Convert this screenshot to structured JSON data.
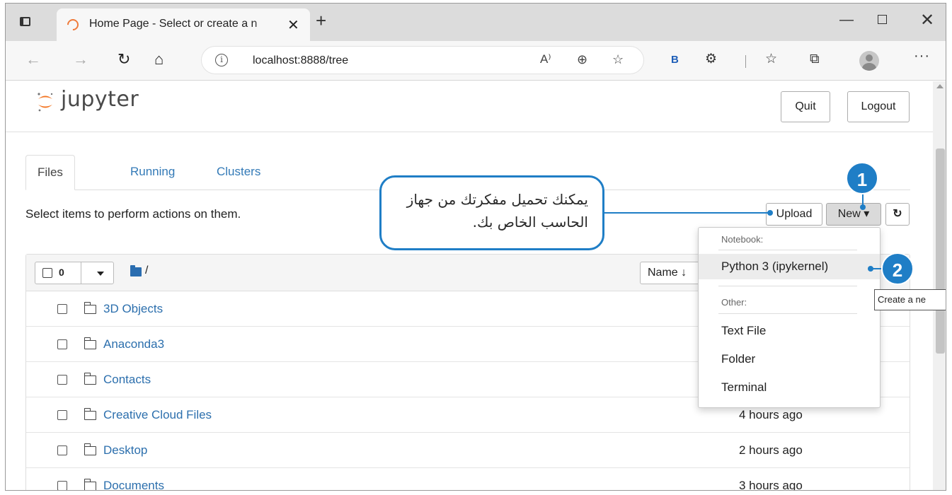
{
  "browser": {
    "tab_title": "Home Page - Select or create a n",
    "url": "localhost:8888/tree",
    "bing_label": "B"
  },
  "header": {
    "brand": "jupyter",
    "quit_label": "Quit",
    "logout_label": "Logout"
  },
  "tabs": [
    {
      "label": "Files",
      "active": true
    },
    {
      "label": "Running",
      "active": false
    },
    {
      "label": "Clusters",
      "active": false
    }
  ],
  "toolbar": {
    "select_message": "Select items to perform actions on them.",
    "upload_label": "Upload",
    "new_label": "New ▾",
    "refresh_glyph": "↻"
  },
  "list_header": {
    "selected_count": "0",
    "root_path": "/",
    "sort_label": "Name ↓"
  },
  "files": [
    {
      "name": "3D Objects",
      "modified": ""
    },
    {
      "name": "Anaconda3",
      "modified": ""
    },
    {
      "name": "Contacts",
      "modified": ""
    },
    {
      "name": "Creative Cloud Files",
      "modified": "4 hours ago"
    },
    {
      "name": "Desktop",
      "modified": "2 hours ago"
    },
    {
      "name": "Documents",
      "modified": "3 hours ago"
    }
  ],
  "new_menu": {
    "notebook_header": "Notebook:",
    "python_item": "Python 3 (ipykernel)",
    "other_header": "Other:",
    "text_file": "Text File",
    "folder": "Folder",
    "terminal": "Terminal"
  },
  "tooltip": "Create a ne",
  "annotations": {
    "callout_text": "يمكنك تحميل مفكرتك من جهاز الحاسب الخاص بك.",
    "badge1": "1",
    "badge2": "2"
  },
  "colors": {
    "accent": "#1f7ec6",
    "link": "#2c6fad",
    "jupyter_orange": "#f37726"
  }
}
